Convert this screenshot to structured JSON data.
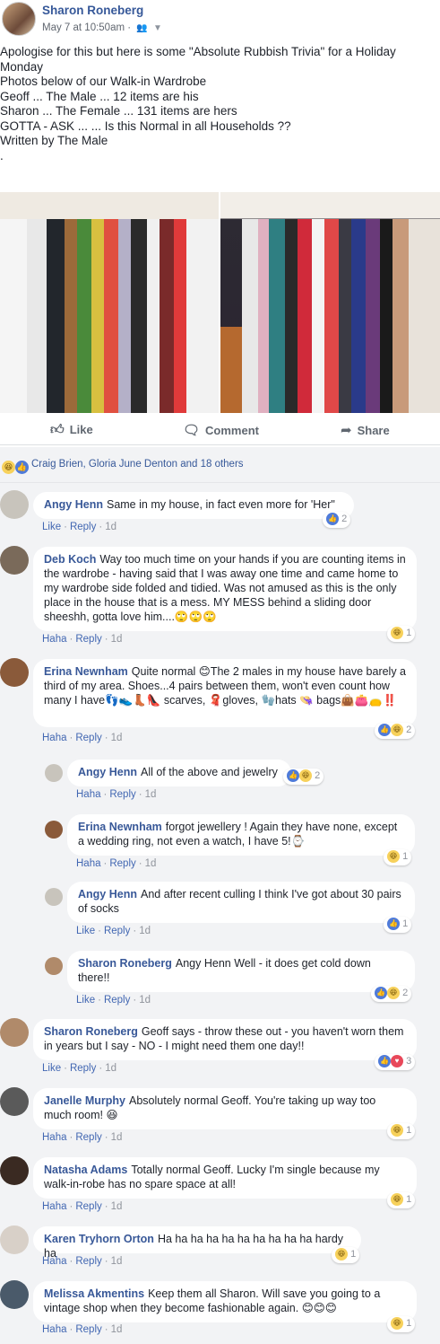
{
  "post": {
    "author": "Sharon Roneberg",
    "timestamp": "May 7 at 10:50am",
    "audience_icon": "friends-icon",
    "text_lines": [
      "Apologise for this but here is some \"Absolute Rubbish Trivia\" for a Holiday",
      "Monday",
      "Photos below of our Walk-in Wardrobe",
      "Geoff ... The Male ... 12 items are his",
      "Sharon ... The Female ... 131 items are hers",
      "GOTTA - ASK ... ... Is this Normal in all Households ??",
      "Written by The Male",
      "."
    ]
  },
  "actions": {
    "like": "Like",
    "comment": "Comment",
    "share": "Share"
  },
  "reactions_summary": {
    "names": "Craig Brien, Gloria June Denton and 18 others"
  },
  "comments": [
    {
      "name": "Angy Henn",
      "text": "Same in my house, in fact even more for 'Her\"",
      "action1": "Like",
      "reply": "Reply",
      "time": "1d",
      "count": "2"
    },
    {
      "name": "Deb Koch",
      "text": "Way too much time on your hands if you are counting items in the wardrobe - having said that I was away one time and came home to my wardrobe side folded and tidied. Was not amused as this is the only place in the house that is a mess. MY MESS behind a sliding door sheeshh, gotta love him....🙄🙄🙄",
      "action1": "Haha",
      "reply": "Reply",
      "time": "1d",
      "count": "1"
    },
    {
      "name": "Erina Newnham",
      "text": "Quite normal 😊The 2 males in my house have barely a third of my area. Shoes...4 pairs between them, won't even count how many I have👣👟👢👠 scarves, 🧣gloves, 🧤hats 👒 bags👜👛👝‼️",
      "action1": "Haha",
      "reply": "Reply",
      "time": "1d",
      "count": "2"
    },
    {
      "name": "Angy Henn",
      "text": "All of the above and jewelry",
      "action1": "Haha",
      "reply": "Reply",
      "time": "1d",
      "count": "2"
    },
    {
      "name": "Erina Newnham",
      "text": "forgot jewellery ! Again they have none, except a wedding ring, not even a watch, I have 5!⌚",
      "action1": "Haha",
      "reply": "Reply",
      "time": "1d",
      "count": "1"
    },
    {
      "name": "Angy Henn",
      "text": "And after recent culling I think I've got about 30 pairs of socks",
      "action1": "Like",
      "reply": "Reply",
      "time": "1d",
      "count": "1"
    },
    {
      "name": "Sharon Roneberg",
      "text": "Angy Henn Well - it does get cold down there!!",
      "action1": "Like",
      "reply": "Reply",
      "time": "1d",
      "count": "2"
    },
    {
      "name": "Sharon Roneberg",
      "text": "Geoff says - throw these out - you haven't worn them in years but I say - NO - I might need them one day!!",
      "action1": "Like",
      "reply": "Reply",
      "time": "1d",
      "count": "3"
    },
    {
      "name": "Janelle Murphy",
      "text": "Absolutely normal Geoff. You're taking up way too much room! 😆",
      "action1": "Haha",
      "reply": "Reply",
      "time": "1d",
      "count": "1"
    },
    {
      "name": "Natasha Adams",
      "text": "Totally normal Geoff. Lucky I'm single because my walk-in-robe has no spare space at all!",
      "action1": "Haha",
      "reply": "Reply",
      "time": "1d",
      "count": "1"
    },
    {
      "name": "Karen Tryhorn Orton",
      "text": "Ha ha ha ha ha ha ha ha ha ha hardy ha",
      "action1": "Haha",
      "reply": "Reply",
      "time": "1d",
      "count": "1"
    },
    {
      "name": "Melissa Akmentins",
      "text": "Keep them all Sharon. Will save you going to a vintage shop when they become fashionable again. 😊😊😊",
      "action1": "Haha",
      "reply": "Reply",
      "time": "1d",
      "count": "1"
    }
  ],
  "colors": {
    "link": "#365899",
    "name": "#385898",
    "action": "#4267b2",
    "bg": "#f2f3f5"
  }
}
